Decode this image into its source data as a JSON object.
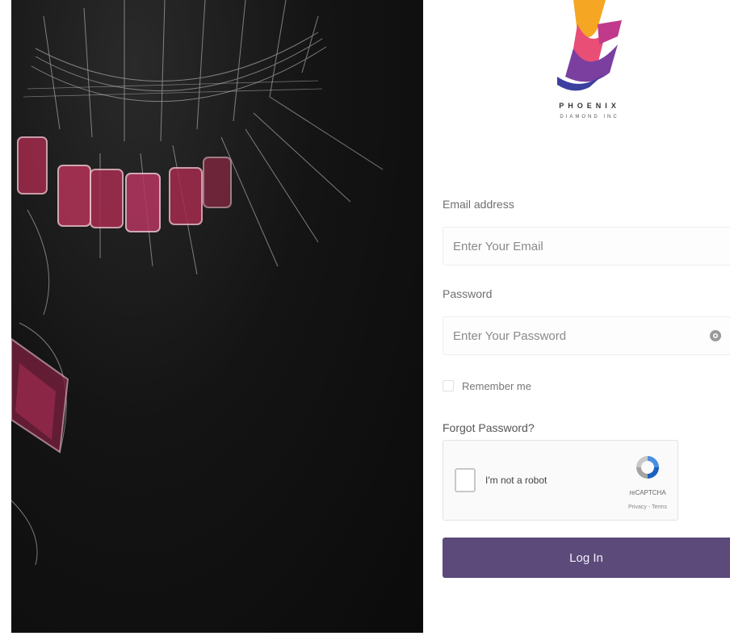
{
  "brand": {
    "name": "PHOENIX",
    "subtitle": "DIAMOND INC",
    "accent": "#5b4a7a"
  },
  "form": {
    "email": {
      "label": "Email address",
      "placeholder": "Enter Your Email",
      "value": ""
    },
    "password": {
      "label": "Password",
      "placeholder": "Enter Your Password",
      "value": "",
      "toggle_icon": "eye-icon"
    },
    "remember_label": "Remember me",
    "forgot_label": "Forgot Password?",
    "recaptcha": {
      "label": "I'm not a robot",
      "brand": "reCAPTCHA",
      "terms": "Privacy - Terms"
    },
    "submit_label": "Log In"
  }
}
